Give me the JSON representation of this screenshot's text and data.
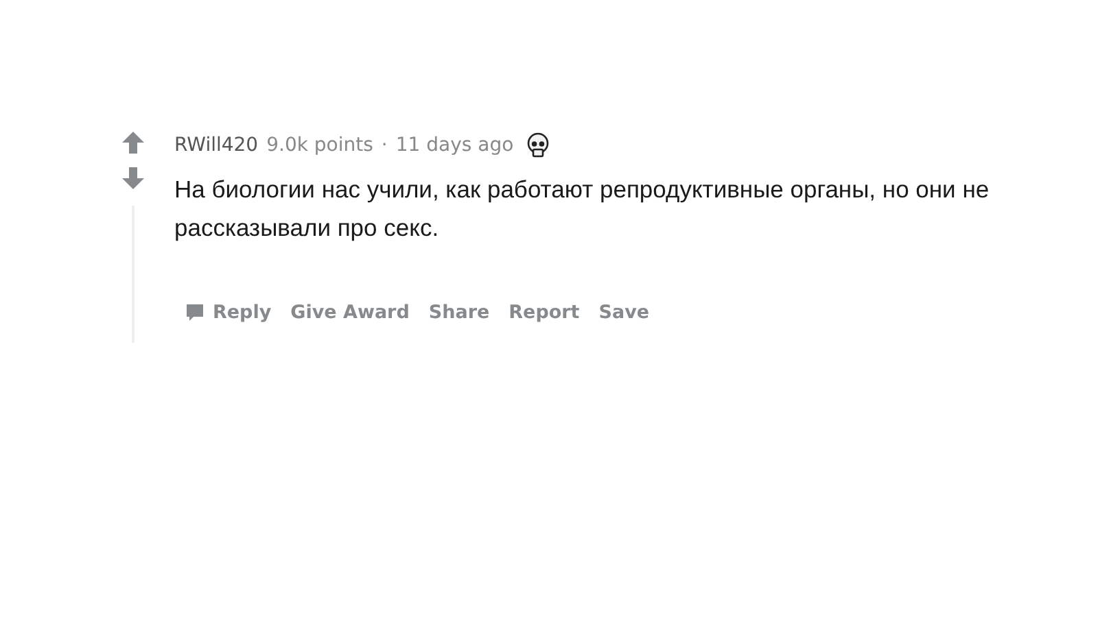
{
  "comment": {
    "author": "RWill420",
    "points": "9.0k points",
    "separator": "·",
    "time": "11 days ago",
    "award": {
      "kind": "skull"
    },
    "body": "На биологии нас учили, как работают репродуктивные органы, но они не рассказывали про секс.",
    "actions": [
      {
        "label": "Reply",
        "kind": "comment"
      },
      {
        "label": "Give Award",
        "kind": "plain"
      },
      {
        "label": "Share",
        "kind": "plain"
      },
      {
        "label": "Report",
        "kind": "plain"
      },
      {
        "label": "Save",
        "kind": "plain"
      }
    ]
  }
}
